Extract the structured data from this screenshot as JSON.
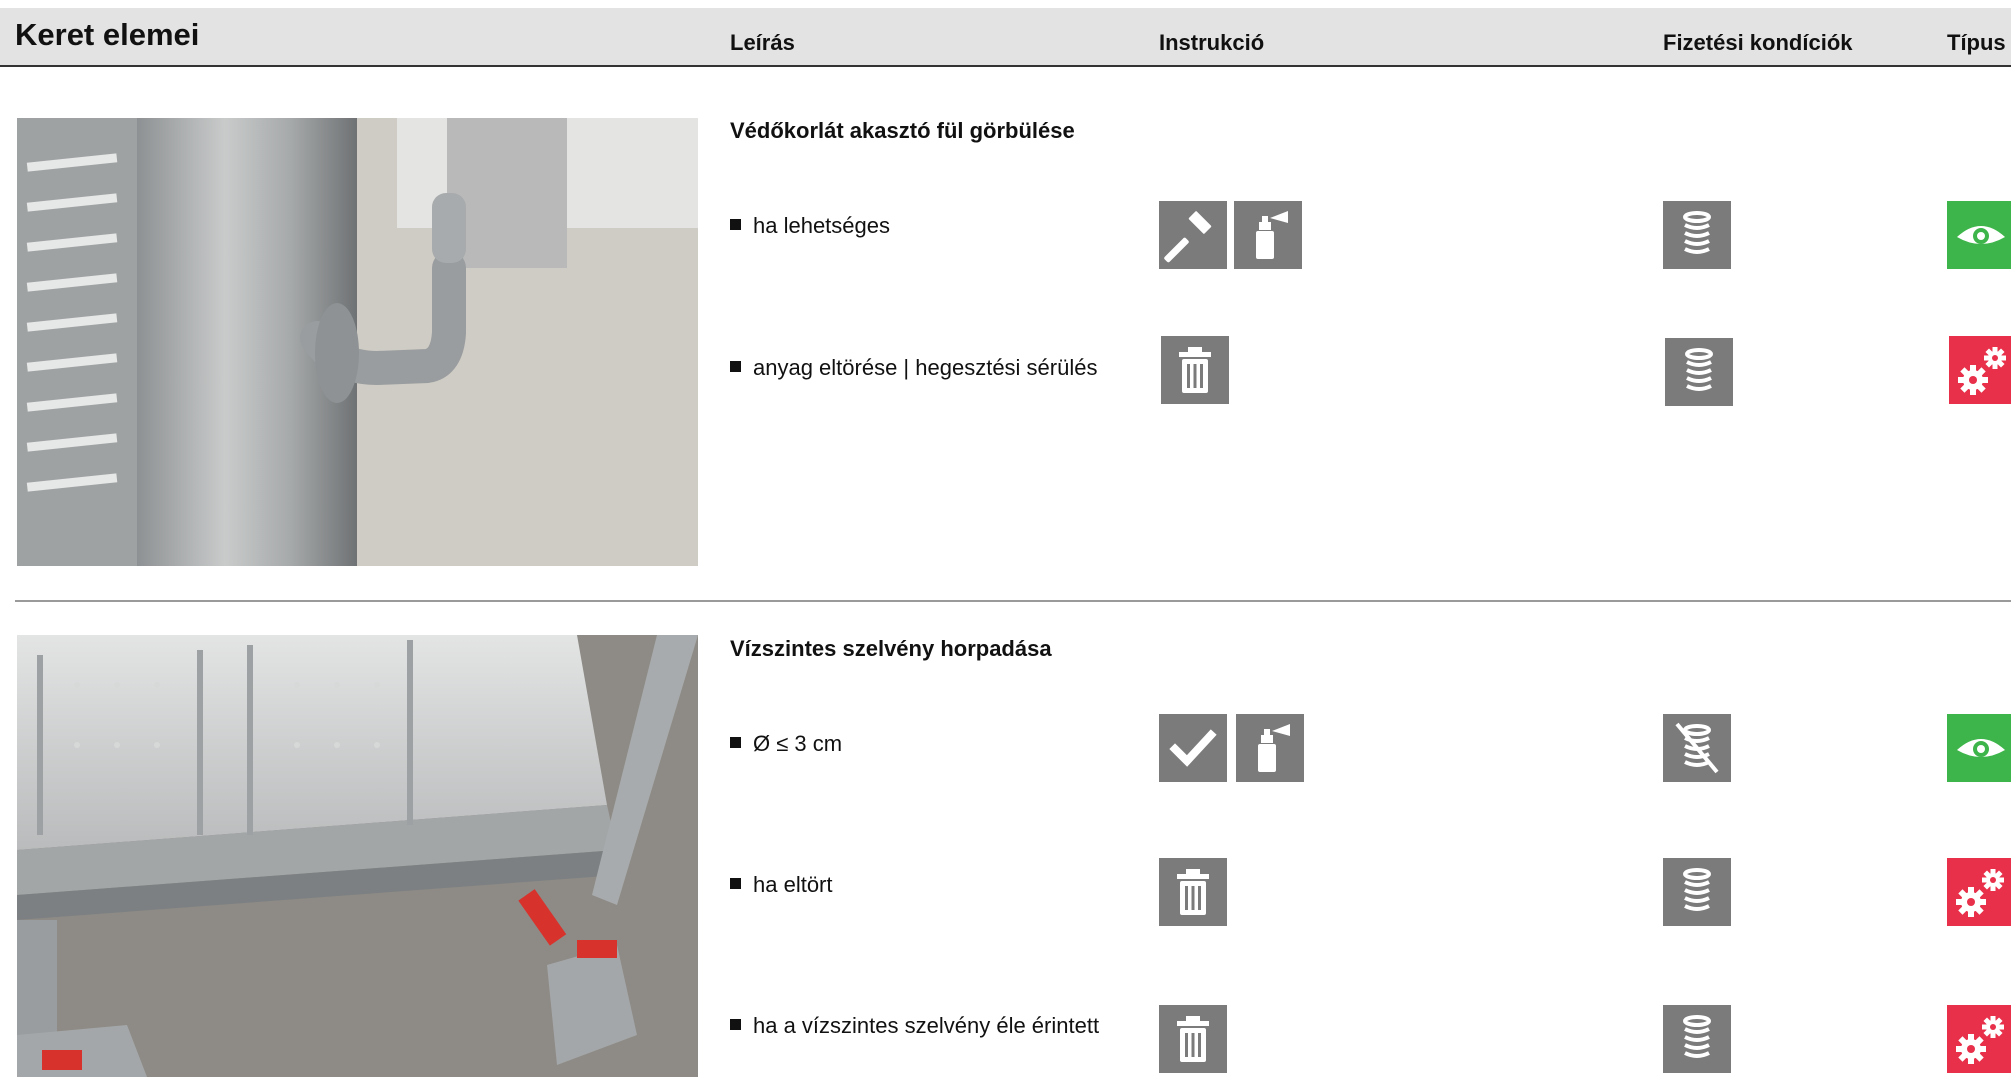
{
  "header": {
    "title": "Keret elemei",
    "col_description": "Leírás",
    "col_instruction": "Instrukció",
    "col_payment": "Fizetési kondíciók",
    "col_type": "Típus"
  },
  "sections": [
    {
      "title": "Védőkorlát akasztó fül görbülése",
      "rows": [
        {
          "text": "ha lehetséges",
          "instructions": [
            "hammer-icon",
            "spray-paint-icon"
          ],
          "payment": "coins-icon",
          "type": "eye-icon"
        },
        {
          "text": "anyag eltörése | hegesztési sérülés",
          "instructions": [
            "trash-icon"
          ],
          "payment": "coins-icon",
          "type": "gears-icon"
        }
      ]
    },
    {
      "title": "Vízszintes szelvény horpadása",
      "rows": [
        {
          "text": "Ø ≤ 3 cm",
          "instructions": [
            "check-icon",
            "spray-paint-icon"
          ],
          "payment": "coins-crossed-icon",
          "type": "eye-icon"
        },
        {
          "text": "ha eltört",
          "instructions": [
            "trash-icon"
          ],
          "payment": "coins-icon",
          "type": "gears-icon"
        },
        {
          "text": "ha a vízszintes szelvény éle érintett",
          "instructions": [
            "trash-icon"
          ],
          "payment": "coins-icon",
          "type": "gears-icon"
        }
      ]
    }
  ],
  "colors": {
    "icon_gray": "#7b7b7b",
    "type_green": "#3eb54a",
    "type_red": "#e8304a",
    "header_bg": "#e3e3e3"
  }
}
